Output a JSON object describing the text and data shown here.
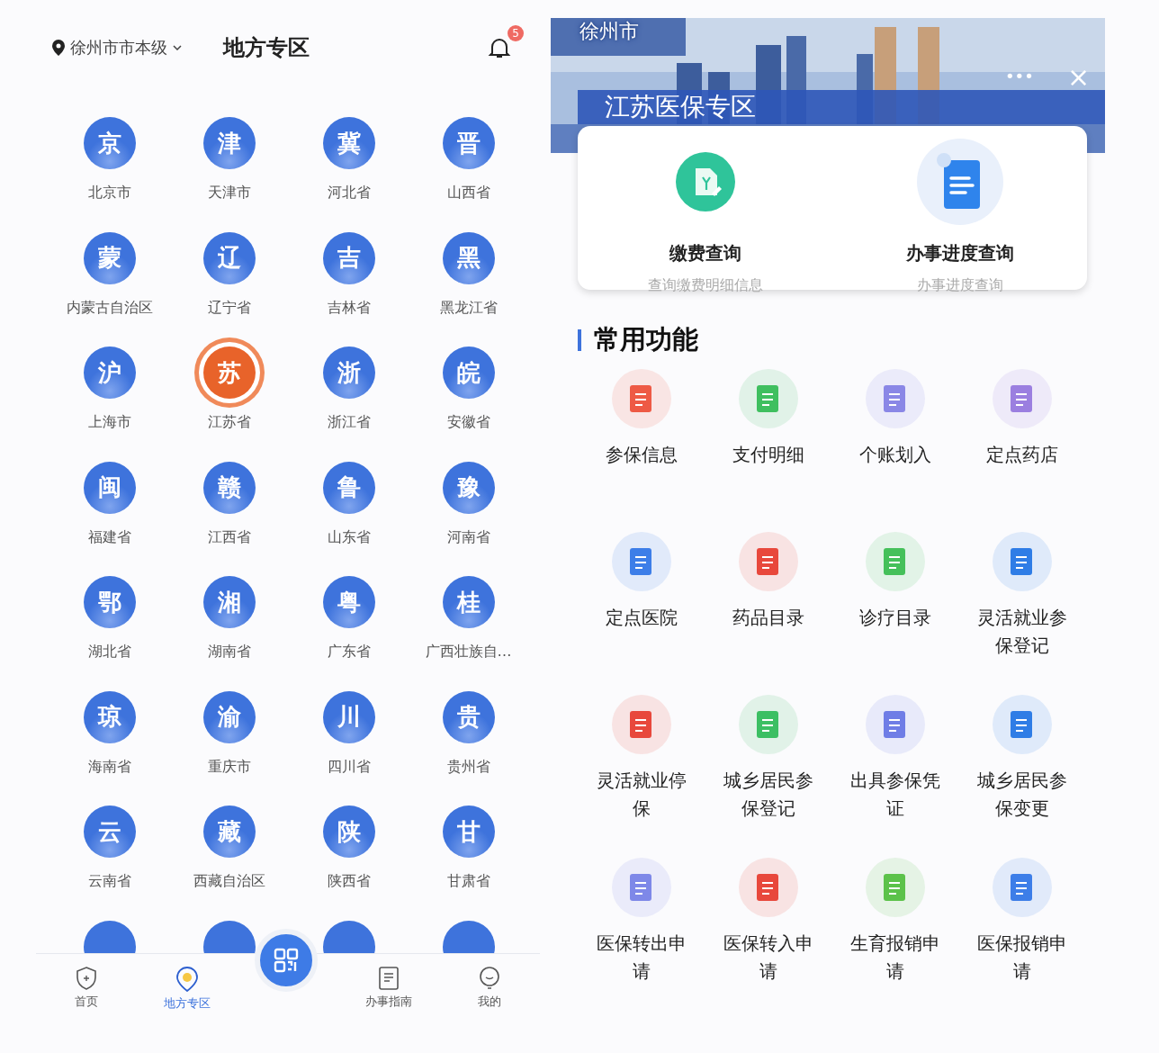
{
  "left_screen": {
    "header": {
      "location": "徐州市市本级",
      "title": "地方专区",
      "notification_count": "5"
    },
    "regions": [
      {
        "glyph": "京",
        "name": "北京市",
        "selected": false
      },
      {
        "glyph": "津",
        "name": "天津市",
        "selected": false
      },
      {
        "glyph": "冀",
        "name": "河北省",
        "selected": false
      },
      {
        "glyph": "晋",
        "name": "山西省",
        "selected": false
      },
      {
        "glyph": "蒙",
        "name": "内蒙古自治区",
        "selected": false
      },
      {
        "glyph": "辽",
        "name": "辽宁省",
        "selected": false
      },
      {
        "glyph": "吉",
        "name": "吉林省",
        "selected": false
      },
      {
        "glyph": "黑",
        "name": "黑龙江省",
        "selected": false
      },
      {
        "glyph": "沪",
        "name": "上海市",
        "selected": false
      },
      {
        "glyph": "苏",
        "name": "江苏省",
        "selected": true
      },
      {
        "glyph": "浙",
        "name": "浙江省",
        "selected": false
      },
      {
        "glyph": "皖",
        "name": "安徽省",
        "selected": false
      },
      {
        "glyph": "闽",
        "name": "福建省",
        "selected": false
      },
      {
        "glyph": "赣",
        "name": "江西省",
        "selected": false
      },
      {
        "glyph": "鲁",
        "name": "山东省",
        "selected": false
      },
      {
        "glyph": "豫",
        "name": "河南省",
        "selected": false
      },
      {
        "glyph": "鄂",
        "name": "湖北省",
        "selected": false
      },
      {
        "glyph": "湘",
        "name": "湖南省",
        "selected": false
      },
      {
        "glyph": "粤",
        "name": "广东省",
        "selected": false
      },
      {
        "glyph": "桂",
        "name": "广西壮族自…",
        "selected": false
      },
      {
        "glyph": "琼",
        "name": "海南省",
        "selected": false
      },
      {
        "glyph": "渝",
        "name": "重庆市",
        "selected": false
      },
      {
        "glyph": "川",
        "name": "四川省",
        "selected": false
      },
      {
        "glyph": "贵",
        "name": "贵州省",
        "selected": false
      },
      {
        "glyph": "云",
        "name": "云南省",
        "selected": false
      },
      {
        "glyph": "藏",
        "name": "西藏自治区",
        "selected": false
      },
      {
        "glyph": "陕",
        "name": "陕西省",
        "selected": false
      },
      {
        "glyph": "甘",
        "name": "甘肃省",
        "selected": false
      }
    ],
    "tab_bar": [
      {
        "kind": "home",
        "label": "首页",
        "selected": false
      },
      {
        "kind": "pin",
        "label": "地方专区",
        "selected": true
      },
      {
        "kind": "scan"
      },
      {
        "kind": "guide",
        "label": "办事指南",
        "selected": false
      },
      {
        "kind": "me",
        "label": "我的",
        "selected": false
      }
    ]
  },
  "right_screen": {
    "banner": {
      "kind": "picture",
      "city": "徐州市",
      "title": "江苏医保专区",
      "more": "•••",
      "close": "×"
    },
    "quick_services": [
      {
        "kind": "payment",
        "title": "缴费查询",
        "subtitle": "查询缴费明细信息"
      },
      {
        "kind": "progress",
        "title": "办事进度查询",
        "subtitle": "办事进度查询"
      }
    ],
    "section_title": "常用功能",
    "functions": [
      {
        "label": "参保信息",
        "color": "#ee5a45"
      },
      {
        "label": "支付明细",
        "color": "#3fbf5f"
      },
      {
        "label": "个账划入",
        "color": "#8a87e6"
      },
      {
        "label": "定点药店",
        "color": "#9b7fe0"
      },
      {
        "label": "定点医院",
        "color": "#3d7ee8"
      },
      {
        "label": "药品目录",
        "color": "#e8483c"
      },
      {
        "label": "诊疗目录",
        "color": "#45c05a"
      },
      {
        "label": "灵活就业参保登记",
        "color": "#2f7de6"
      },
      {
        "label": "灵活就业停保",
        "color": "#e8483c"
      },
      {
        "label": "城乡居民参保登记",
        "color": "#3cbf63"
      },
      {
        "label": "出具参保凭证",
        "color": "#6f7de6"
      },
      {
        "label": "城乡居民参保变更",
        "color": "#2f7de6"
      },
      {
        "label": "医保转出申请",
        "color": "#7e88e8"
      },
      {
        "label": "医保转入申请",
        "color": "#e8483c"
      },
      {
        "label": "生育报销申请",
        "color": "#5cc24a"
      },
      {
        "label": "医保报销申请",
        "color": "#3d7ee8"
      }
    ]
  }
}
